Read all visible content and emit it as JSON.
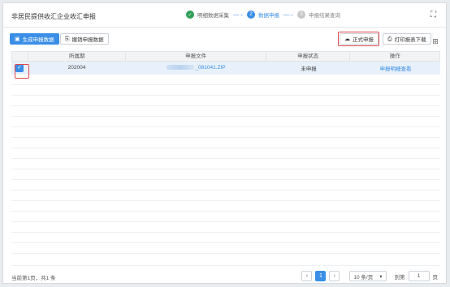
{
  "header": {
    "title": "非居民提供收汇企业收汇申报",
    "expand_icon": "expand-icon"
  },
  "steps": [
    {
      "num": "✓",
      "label": "明细数据采集",
      "state": "done"
    },
    {
      "num": "2",
      "label": "数据申报",
      "state": "active"
    },
    {
      "num": "3",
      "label": "申报结果查询",
      "state": "todo"
    }
  ],
  "toolbar": {
    "generate_label": "生成申报数据",
    "withdraw_label": "撤销申报数据",
    "formal_label": "正式申报",
    "print_label": "打印报表下载"
  },
  "table": {
    "headers": [
      "所属期",
      "申报文件",
      "申报状态",
      "操作"
    ],
    "rows": [
      {
        "checked": true,
        "period": "202004",
        "file": "_081041.ZIP",
        "status": "未申报",
        "action": "申报明细查看"
      }
    ]
  },
  "footer": {
    "summary": "当前第1页，共1 条",
    "current_page": "1",
    "page_size": "10 条/页",
    "goto_label": "到第",
    "goto_value": "1",
    "page_suffix": "页"
  },
  "colors": {
    "accent": "#3a8ee6",
    "done": "#2f9f57",
    "highlight": "#e0474c"
  }
}
